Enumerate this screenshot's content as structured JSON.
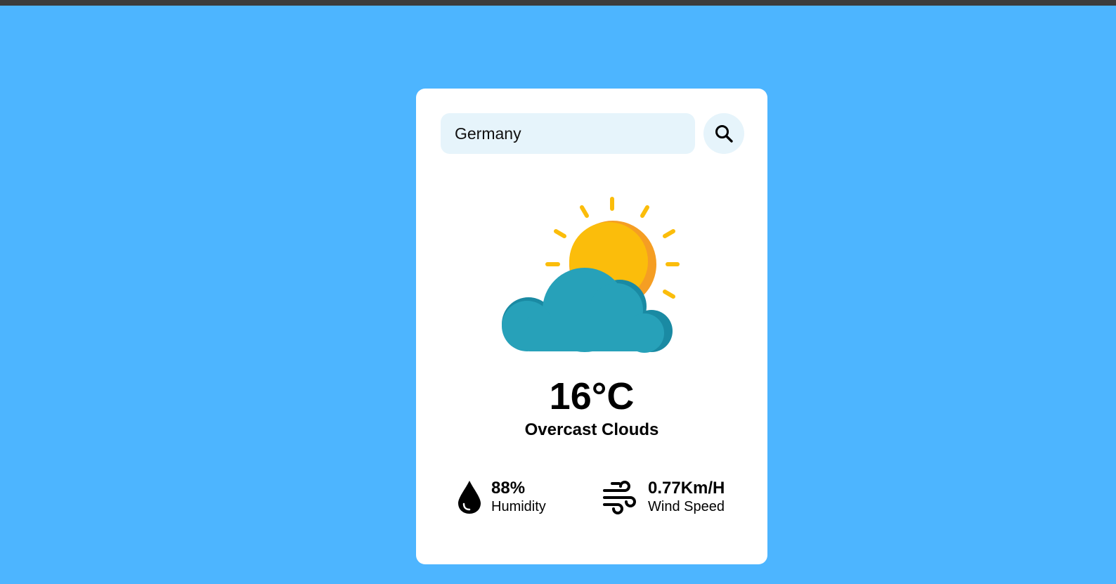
{
  "search": {
    "value": "Germany",
    "icon": "search-icon"
  },
  "weather": {
    "icon": "partly-cloudy-icon",
    "temperature": "16°C",
    "description": "Overcast Clouds"
  },
  "humidity": {
    "icon": "water-drop-icon",
    "value": "88%",
    "label": "Humidity"
  },
  "wind": {
    "icon": "wind-icon",
    "value": "0.77Km/H",
    "label": "Wind Speed"
  },
  "colors": {
    "background": "#4db5ff",
    "card": "#ffffff",
    "input_bg": "#e6f4fb",
    "sun": "#fbbd0b",
    "sun_shadow": "#f59e23",
    "cloud": "#27a1b9",
    "cloud_shadow": "#1a8aa3"
  }
}
